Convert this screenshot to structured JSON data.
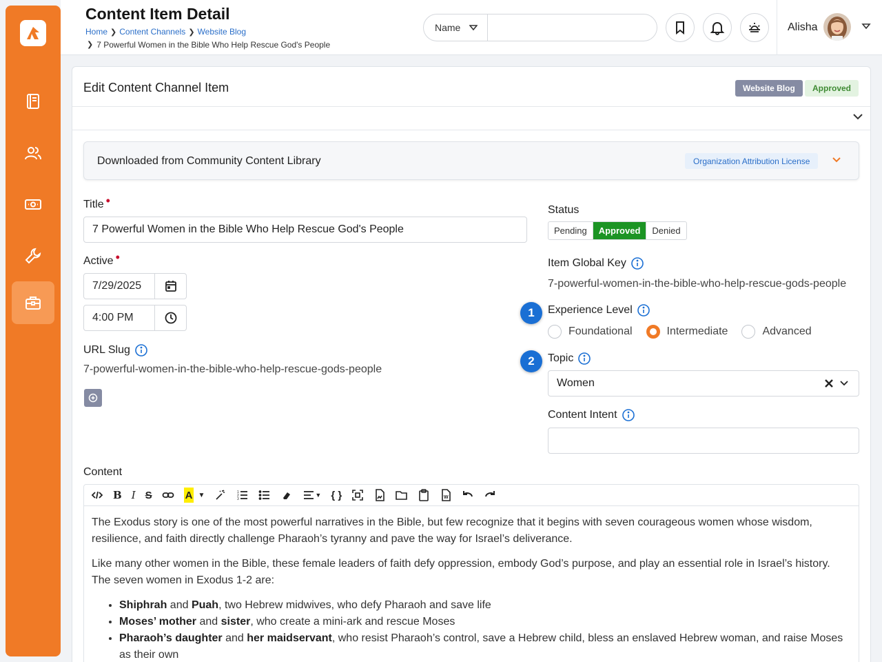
{
  "header": {
    "title": "Content Item Detail",
    "breadcrumbs": [
      "Home",
      "Content Channels",
      "Website Blog"
    ],
    "breadcrumb_current": "7 Powerful Women in the Bible Who Help Rescue God's People",
    "search_scope": "Name",
    "search_value": "",
    "user_name": "Alisha"
  },
  "sidebar": {
    "items": [
      "book-icon",
      "people-icon",
      "finance-icon",
      "wrench-icon",
      "briefcase-icon"
    ],
    "active_index": 4
  },
  "card": {
    "title": "Edit Content Channel Item",
    "channel_badge": "Website Blog",
    "status_badge": "Approved"
  },
  "library": {
    "text": "Downloaded from Community Content Library",
    "license": "Organization Attribution License"
  },
  "form": {
    "title_label": "Title",
    "title_value": "7 Powerful Women in the Bible Who Help Rescue God's People",
    "active_label": "Active",
    "active_date": "7/29/2025",
    "active_time": "4:00 PM",
    "url_slug_label": "URL Slug",
    "url_slug_value": "7-powerful-women-in-the-bible-who-help-rescue-gods-people",
    "status_label": "Status",
    "status_options": [
      "Pending",
      "Approved",
      "Denied"
    ],
    "status_selected": "Approved",
    "global_key_label": "Item Global Key",
    "global_key_value": "7-powerful-women-in-the-bible-who-help-rescue-gods-people",
    "experience_label": "Experience Level",
    "experience_options": [
      "Foundational",
      "Intermediate",
      "Advanced"
    ],
    "experience_selected": "Intermediate",
    "topic_label": "Topic",
    "topic_value": "Women",
    "intent_label": "Content Intent",
    "intent_value": "",
    "content_label": "Content",
    "callouts": [
      "1",
      "2"
    ]
  },
  "content": {
    "p1": "The Exodus story is one of the most powerful narratives in the Bible, but few recognize that it begins with seven courageous women whose wisdom, resilience, and faith directly challenge Pharaoh’s tyranny and pave the way for Israel’s deliverance.",
    "p2": "Like many other women in the Bible, these female leaders of faith defy oppression, embody God’s purpose, and play an essential role in Israel’s history. The seven women in Exodus 1-2 are:",
    "list": [
      {
        "b1": "Shiphrah",
        "m1": " and ",
        "b2": "Puah",
        "rest": ", two Hebrew midwives, who defy Pharaoh and save life"
      },
      {
        "b1": "Moses’ mother",
        "m1": " and ",
        "b2": "sister",
        "rest": ", who create a mini-ark and rescue Moses"
      },
      {
        "b1": "Pharaoh’s daughter",
        "m1": " and ",
        "b2": "her maidservant",
        "rest": ", who resist Pharaoh’s control, save a Hebrew child, bless an enslaved Hebrew woman, and raise Moses as their own"
      }
    ]
  },
  "colors": {
    "brand": "#f07a26",
    "approved": "#1c9424",
    "link": "#2a6ec8",
    "callout": "#1a6fd4"
  }
}
